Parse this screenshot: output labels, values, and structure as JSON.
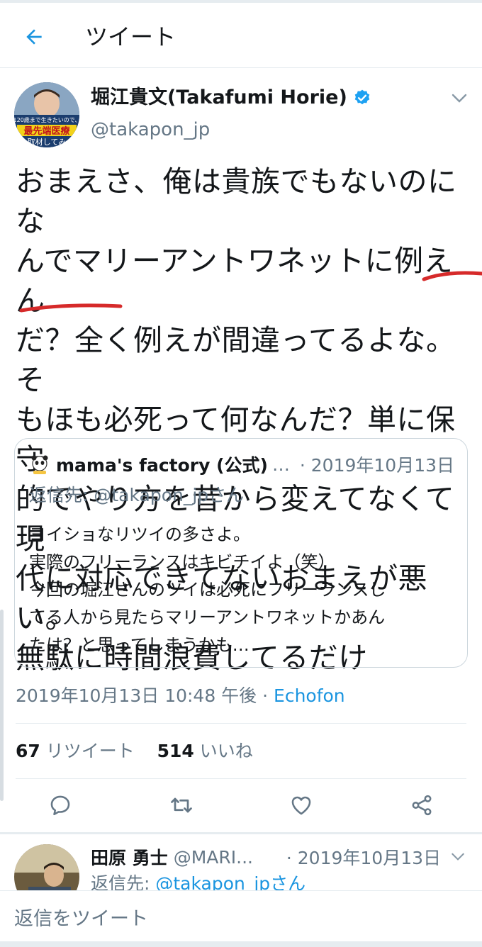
{
  "header": {
    "title": "ツイート"
  },
  "tweet": {
    "author_name": "堀江貴文(Takafumi Horie)",
    "author_handle": "@takapon_jp",
    "avatar_banner": {
      "top": "120歳まで生きたいので、",
      "mid": "最先端医療",
      "bot": "取材してみ"
    },
    "text": "おまえさ、俺は貴族でもないのにな\nんでマリーアントワネットに例えん\nだ？全く例えが間違ってるよな。そ\nもほも必死って何なんだ？単に保守\n的でやり方を昔から変えてなくて現\n代に対応できてないおまえが悪い。\n無駄に時間浪費してるだけ",
    "timestamp": "2019年10月13日 10:48 午後",
    "meta_sep": " · ",
    "source": "Echofon",
    "retweet_count": "67",
    "retweet_label": "リツイート",
    "like_count": "514",
    "like_label": "いいね"
  },
  "quote": {
    "name": "mama's factory (公式)",
    "dots": "…",
    "time": "· 2019年10月13日",
    "reply_to": "返信先: @takapon_jpさん",
    "body": "ヨイショなリツイの多さよ。\n実際のフリーランスはキビチイよ（笑）\n今回の堀江さんのツイは必死にフリーランスし\nてる人から見たらマリーアントワネットかあん\nたは？と思ってしまうかも…"
  },
  "reply": {
    "name": "田原 勇士",
    "handle": "@MARI...",
    "time": "· 2019年10月13日",
    "reply_prefix": "返信先: ",
    "reply_link": "@takapon_jpさん"
  },
  "composer": {
    "placeholder": "返信をツイート"
  },
  "colors": {
    "accent": "#1b95e0",
    "muted": "#657786",
    "divider": "#e6ecf0",
    "scribble": "#d62a2a",
    "verified": "#1da1f2"
  }
}
